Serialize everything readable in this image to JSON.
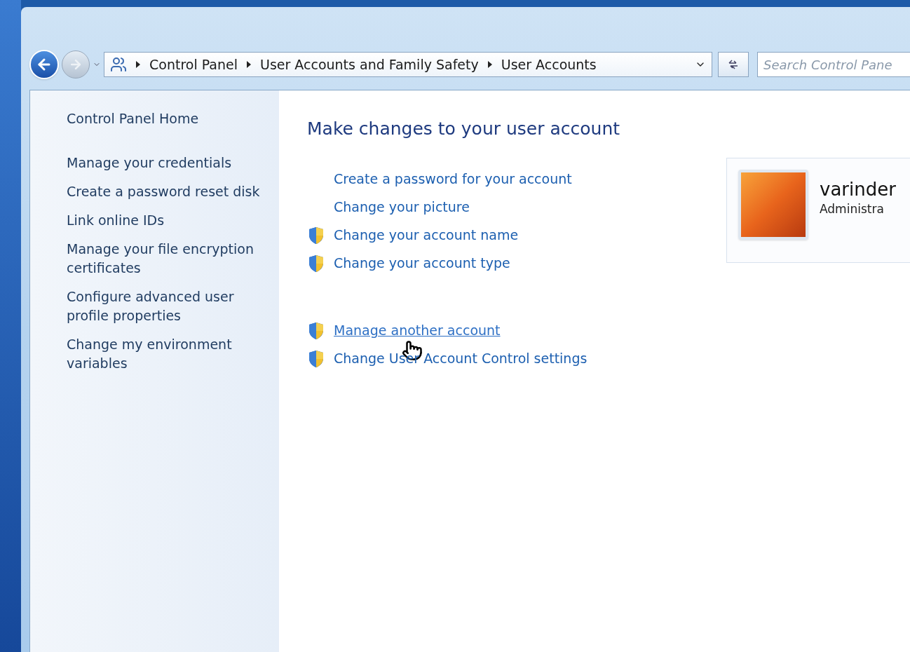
{
  "breadcrumb": [
    "Control Panel",
    "User Accounts and Family Safety",
    "User Accounts"
  ],
  "search": {
    "placeholder": "Search Control Pane"
  },
  "sidebar": {
    "items": [
      {
        "label": "Control Panel Home",
        "kind": "home"
      },
      {
        "label": "Manage your credentials",
        "kind": "link"
      },
      {
        "label": "Create a password reset disk",
        "kind": "link"
      },
      {
        "label": "Link online IDs",
        "kind": "link"
      },
      {
        "label": "Manage your file encryption certificates",
        "kind": "link"
      },
      {
        "label": "Configure advanced user profile properties",
        "kind": "link"
      },
      {
        "label": "Change my environment variables",
        "kind": "link"
      }
    ]
  },
  "main": {
    "title": "Make changes to your user account",
    "task_groups": [
      [
        {
          "label": "Create a password for your account",
          "shield": false,
          "hovered": false
        },
        {
          "label": "Change your picture",
          "shield": false,
          "hovered": false
        },
        {
          "label": "Change your account name",
          "shield": true,
          "hovered": false
        },
        {
          "label": "Change your account type",
          "shield": true,
          "hovered": false
        }
      ],
      [
        {
          "label": "Manage another account",
          "shield": true,
          "hovered": true
        },
        {
          "label": "Change User Account Control settings",
          "shield": true,
          "hovered": false
        }
      ]
    ]
  },
  "account": {
    "name": "varinder",
    "role": "Administra"
  }
}
